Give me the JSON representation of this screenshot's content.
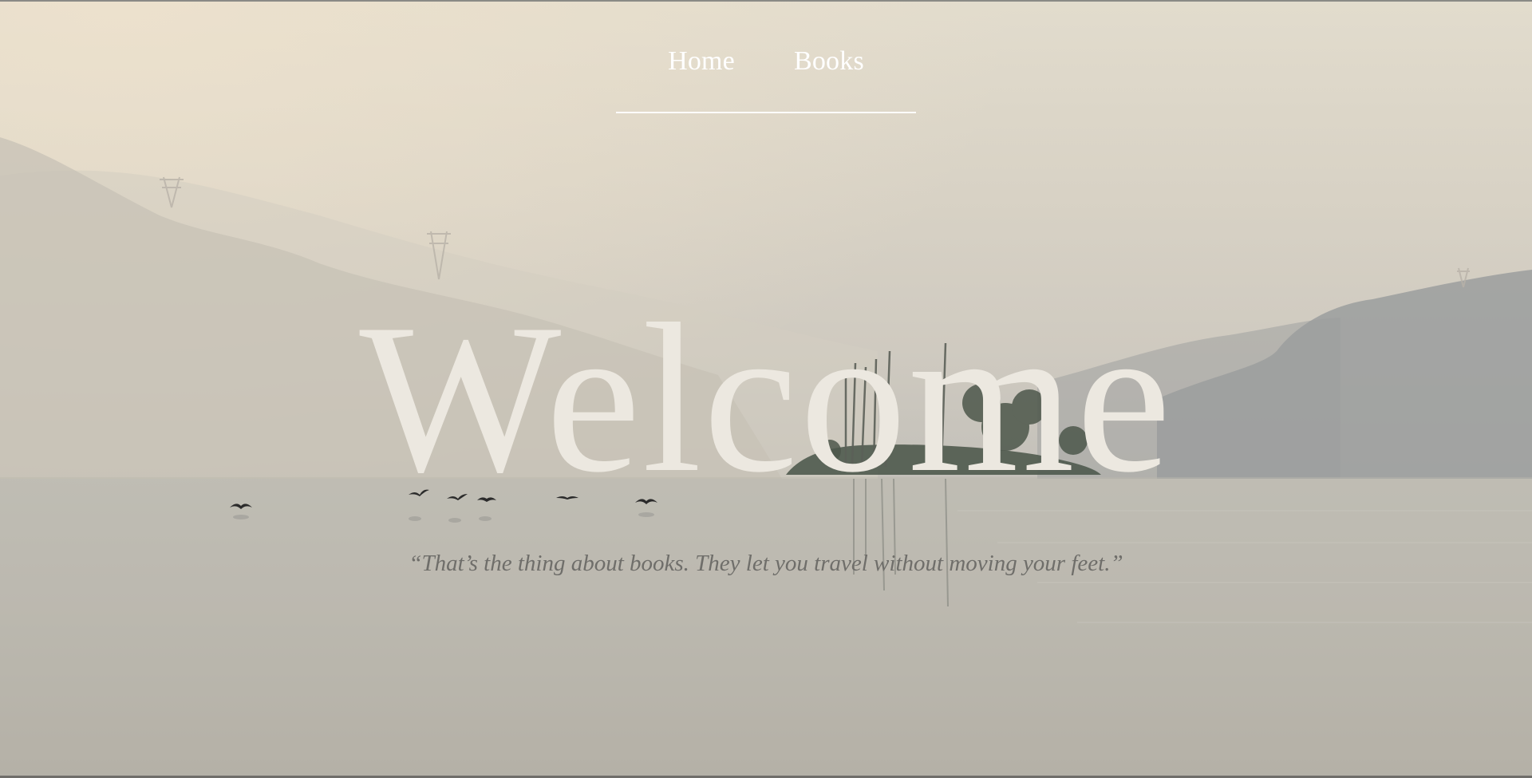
{
  "nav": {
    "items": [
      {
        "label": "Home"
      },
      {
        "label": "Books"
      }
    ]
  },
  "hero": {
    "title": "Welcome",
    "quote": "“That’s the thing about books. They let you travel without moving your feet.”"
  },
  "colors": {
    "nav_text": "#ffffff",
    "title_text": "#ece8e0",
    "quote_text": "#6f6e6a",
    "sky": "#e2dccd",
    "water": "#bdb9b1"
  },
  "background": {
    "image": "misty-lake-landscape"
  }
}
